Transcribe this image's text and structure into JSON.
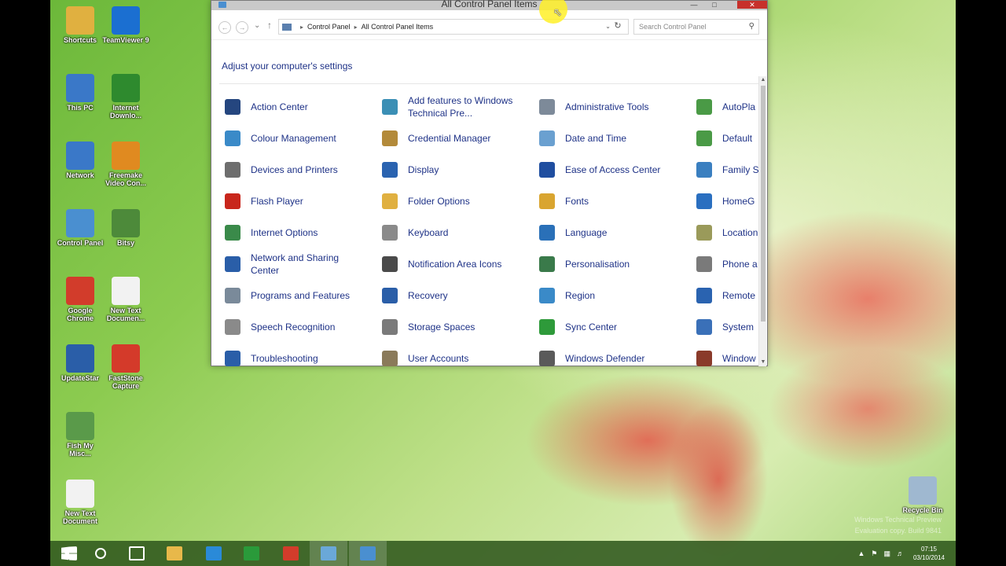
{
  "desktop": {
    "icons": [
      {
        "label": "Shortcuts",
        "icon": "folder-icon",
        "color": "#e0b040"
      },
      {
        "label": "TeamViewer 9",
        "icon": "teamviewer-icon",
        "color": "#1b6fd1"
      },
      {
        "label": "This PC",
        "icon": "computer-icon",
        "color": "#3a78c8"
      },
      {
        "label": "Internet Downlo...",
        "icon": "download-manager-icon",
        "color": "#2e8a2e"
      },
      {
        "label": "Network",
        "icon": "network-icon",
        "color": "#3a78c8"
      },
      {
        "label": "Freemake Video Con...",
        "icon": "video-converter-icon",
        "color": "#e08a20"
      },
      {
        "label": "Control Panel",
        "icon": "control-panel-icon",
        "color": "#4a8fd0"
      },
      {
        "label": "Bitsy",
        "icon": "app-icon",
        "color": "#4d8a3a"
      },
      {
        "label": "Google Chrome",
        "icon": "chrome-icon",
        "color": "#d23c2b"
      },
      {
        "label": "New Text Documen...",
        "icon": "text-document-icon",
        "color": "#f2f2f2"
      },
      {
        "label": "UpdateStar",
        "icon": "updatestar-icon",
        "color": "#2a5ea8"
      },
      {
        "label": "FastStone Capture",
        "icon": "faststone-icon",
        "color": "#d43a2a"
      },
      {
        "label": "Fish My Misc...",
        "icon": "screen-capture-icon",
        "color": "#5a9a4a"
      },
      {
        "label": "New Text Document",
        "icon": "text-document-icon",
        "color": "#f2f2f2"
      },
      {
        "label": "Recycle Bin",
        "icon": "recycle-bin-icon",
        "color": "#9fb8d0"
      }
    ]
  },
  "window": {
    "title": "All Control Panel Items",
    "minimize": "—",
    "maximize": "□",
    "close": "✕",
    "breadcrumb": [
      "Control Panel",
      "All Control Panel Items"
    ],
    "search_placeholder": "Search Control Panel",
    "heading": "Adjust your computer's settings",
    "items": [
      {
        "label": "Action Center",
        "icon": "flag-icon",
        "color": "#25467f"
      },
      {
        "label": "Add features to Windows Technical Pre...",
        "icon": "add-features-icon",
        "color": "#3b8fb5"
      },
      {
        "label": "Administrative Tools",
        "icon": "admin-tools-icon",
        "color": "#7d8a99"
      },
      {
        "label": "AutoPla",
        "icon": "autoplay-icon",
        "color": "#4a9a46"
      },
      {
        "label": "Colour Management",
        "icon": "colour-management-icon",
        "color": "#3a8ac8"
      },
      {
        "label": "Credential Manager",
        "icon": "credential-manager-icon",
        "color": "#b38a3a"
      },
      {
        "label": "Date and Time",
        "icon": "date-time-icon",
        "color": "#6aa0d0"
      },
      {
        "label": "Default",
        "icon": "default-programs-icon",
        "color": "#4a9a46"
      },
      {
        "label": "Devices and Printers",
        "icon": "printer-icon",
        "color": "#6e6e6e"
      },
      {
        "label": "Display",
        "icon": "display-icon",
        "color": "#2a63b0"
      },
      {
        "label": "Ease of Access Center",
        "icon": "ease-of-access-icon",
        "color": "#1f4ea0"
      },
      {
        "label": "Family S",
        "icon": "family-safety-icon",
        "color": "#3a7fc0"
      },
      {
        "label": "Flash Player",
        "icon": "flash-icon",
        "color": "#c8261c"
      },
      {
        "label": "Folder Options",
        "icon": "folder-options-icon",
        "color": "#e0b040"
      },
      {
        "label": "Fonts",
        "icon": "fonts-icon",
        "color": "#d9a530"
      },
      {
        "label": "HomeG",
        "icon": "homegroup-icon",
        "color": "#2a6fc0"
      },
      {
        "label": "Internet Options",
        "icon": "internet-options-icon",
        "color": "#3a8a4a"
      },
      {
        "label": "Keyboard",
        "icon": "keyboard-icon",
        "color": "#8a8a8a"
      },
      {
        "label": "Language",
        "icon": "language-icon",
        "color": "#2a70b8"
      },
      {
        "label": "Location",
        "icon": "location-icon",
        "color": "#9a9a5a"
      },
      {
        "label": "Network and Sharing Center",
        "icon": "network-sharing-icon",
        "color": "#2a5ea8"
      },
      {
        "label": "Notification Area Icons",
        "icon": "notification-icons-icon",
        "color": "#4a4a4a"
      },
      {
        "label": "Personalisation",
        "icon": "personalisation-icon",
        "color": "#3a7a4a"
      },
      {
        "label": "Phone a",
        "icon": "phone-modem-icon",
        "color": "#7a7a7a"
      },
      {
        "label": "Programs and Features",
        "icon": "programs-features-icon",
        "color": "#7a8a9a"
      },
      {
        "label": "Recovery",
        "icon": "recovery-icon",
        "color": "#2a5ea8"
      },
      {
        "label": "Region",
        "icon": "region-icon",
        "color": "#3a8ac8"
      },
      {
        "label": "Remote Connect",
        "icon": "remote-app-icon",
        "color": "#2a63b0"
      },
      {
        "label": "Speech Recognition",
        "icon": "microphone-icon",
        "color": "#8a8a8a"
      },
      {
        "label": "Storage Spaces",
        "icon": "storage-spaces-icon",
        "color": "#7a7a7a"
      },
      {
        "label": "Sync Center",
        "icon": "sync-center-icon",
        "color": "#2e9a3a"
      },
      {
        "label": "System",
        "icon": "system-icon",
        "color": "#3a70b8"
      },
      {
        "label": "Troubleshooting",
        "icon": "troubleshooting-icon",
        "color": "#2a5ea8"
      },
      {
        "label": "User Accounts",
        "icon": "user-accounts-icon",
        "color": "#8a7a5a"
      },
      {
        "label": "Windows Defender",
        "icon": "windows-defender-icon",
        "color": "#5a5a5a"
      },
      {
        "label": "Window",
        "icon": "windows-update-icon",
        "color": "#8a3a2a"
      }
    ]
  },
  "taskbar": {
    "buttons": [
      {
        "name": "start-button",
        "icon": "windows-logo-icon",
        "color": "#ffffff"
      },
      {
        "name": "search-button",
        "icon": "search-icon",
        "color": "#ffffff"
      },
      {
        "name": "task-view-button",
        "icon": "task-view-icon",
        "color": "#ffffff"
      },
      {
        "name": "file-explorer-button",
        "icon": "folder-icon",
        "color": "#e8b84a"
      },
      {
        "name": "internet-explorer-button",
        "icon": "internet-explorer-icon",
        "color": "#2a8ad8"
      },
      {
        "name": "store-button",
        "icon": "store-icon",
        "color": "#2a9a3a"
      },
      {
        "name": "chrome-button",
        "icon": "chrome-icon",
        "color": "#d23c2b"
      },
      {
        "name": "app-button",
        "icon": "app-icon",
        "color": "#6aa8d8"
      },
      {
        "name": "control-panel-button",
        "icon": "control-panel-icon",
        "color": "#4a8fd0"
      }
    ],
    "clock_time": "07:15",
    "clock_date": "03/10/2014"
  },
  "watermark": {
    "line1": "Windows Technical Preview",
    "line2": "Evaluation copy. Build 9841"
  }
}
